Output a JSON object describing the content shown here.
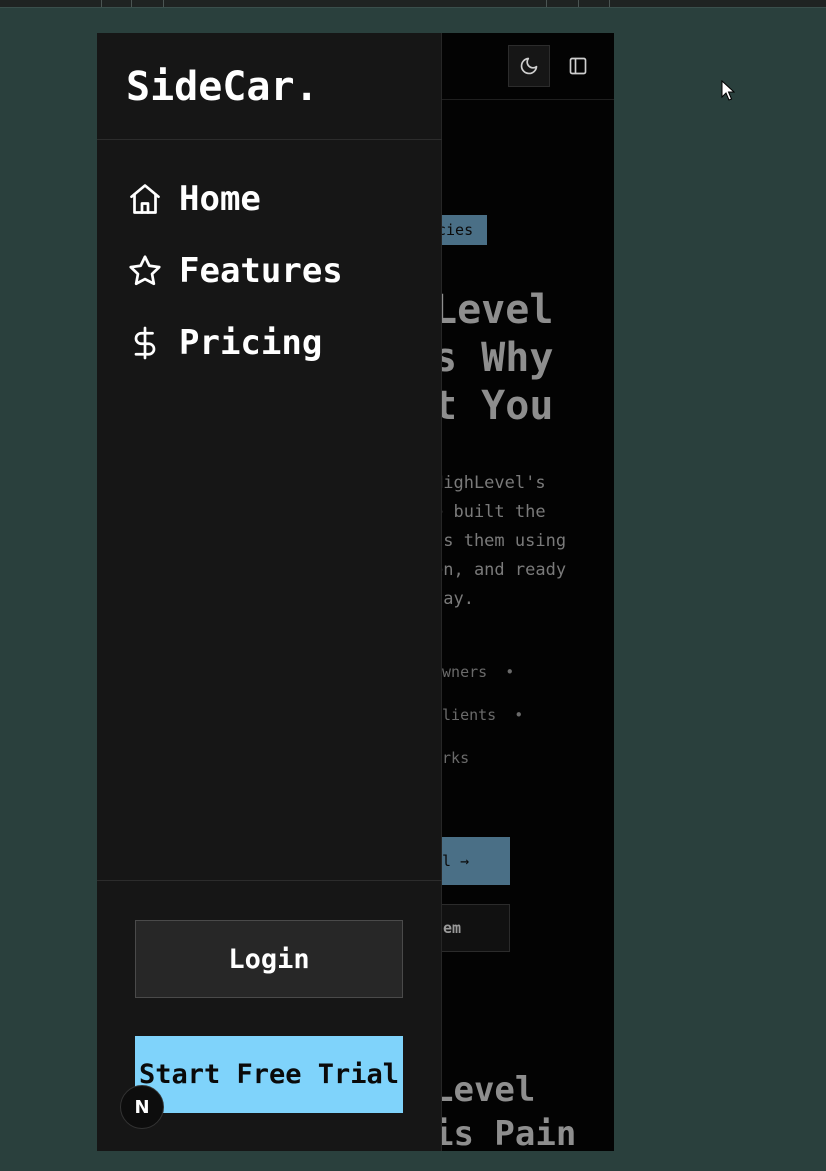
{
  "brand": {
    "logo": "SideCar."
  },
  "nav": {
    "items": [
      {
        "label": "Home",
        "icon": "home-icon"
      },
      {
        "label": "Features",
        "icon": "star-icon"
      },
      {
        "label": "Pricing",
        "icon": "dollar-icon"
      }
    ]
  },
  "actions": {
    "login_label": "Login",
    "trial_label": "Start Free Trial"
  },
  "header": {
    "theme_icon": "moon-icon",
    "sidebar_icon": "sidebar-toggle-icon"
  },
  "hero": {
    "badge": "cies",
    "title": "Level\ns Why\nt You",
    "subtitle": "HighLevel's\ne built the\nts them using\nen, and ready\nday.",
    "bullets": "owners  •\nclients  •\norks",
    "trial_cta": "al →",
    "system_cta": "tem",
    "section_title": "Level\nis Pain"
  },
  "framework_badge": "N",
  "colors": {
    "accent": "#7fd3fb",
    "drawer_bg": "#161616",
    "page_bg": "#2a403d"
  }
}
